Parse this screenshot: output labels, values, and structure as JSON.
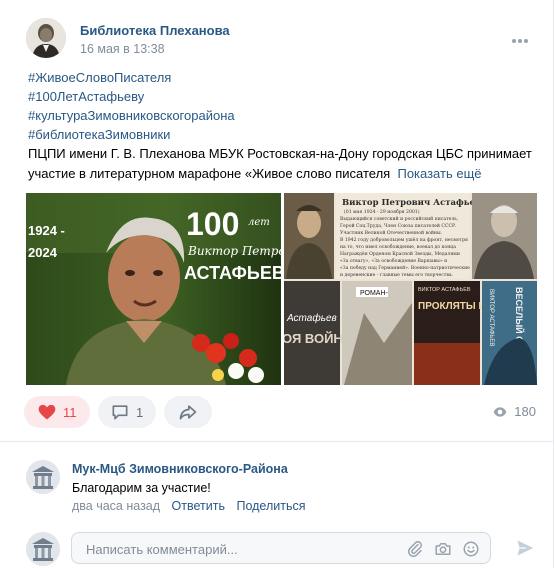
{
  "post": {
    "author": "Библиотека Плеханова",
    "date": "16 мая в 13:38",
    "hashtags": [
      "#ЖивоеСловоПисателя",
      "#100ЛетАстафьеву",
      "#культураЗимовниковскогорайона",
      "#библиотекаЗимовники"
    ],
    "text": "ПЦПИ имени Г. В. Плеханова МБУК Ростовская-на-Дону городская ЦБС принимает участие в литературном марафоне «Живое слово писателя",
    "show_more": "Показать ещё",
    "photo1": {
      "years_start": "1924 -",
      "years_end": "2024",
      "big_number": "100",
      "small_word": "лет",
      "script_name": "Виктор Петрович",
      "surname": "АСТАФЬЕВ"
    },
    "photo2": {
      "heading": "Виктор Петрович Астафьев",
      "bio_lines": [
        "(01 мая 1924 - 29 ноября 2001)",
        "Выдающийся советский и российский писатель,",
        "Герой Соц.Труда, Член Союза писателей СССР.",
        "Участник Великой Отечественной войны.",
        "В 1942 году добровольцем ушёл на фронт, несмотря",
        "на то, что имел освобождение, воевал до конца",
        "Награждён Орденом Красной Звезды, Медалями",
        "«За отвагу», «За освобождение Варшавы» и",
        "«За победу над Германией». Военно-патриотические",
        "и деревенские - главные темы его творчества."
      ],
      "book1_author": "Астафьев",
      "book1_title": "ОЯ ВОЙНА",
      "book2_author": "РОМАН-",
      "book3_author": "ВИКТОР АСТАФЬЕВ",
      "book3_title": "ПРОКЛЯТЫ И УБИТЫ",
      "book4_title": "ВЕСЕЛЫЙ СОЛДАТ",
      "book4_author": "ВИКТОР АСТАФЬЕВ"
    },
    "actions": {
      "likes": "11",
      "comments": "1",
      "views": "180"
    }
  },
  "comment": {
    "author": "Мук-Мцб Зимовниковского-Района",
    "text": "Благодарим за участие!",
    "time": "два часа назад",
    "reply_label": "Ответить",
    "share_label": "Поделиться"
  },
  "reply": {
    "placeholder": "Написать комментарий..."
  },
  "colors": {
    "link": "#2a5885",
    "meta": "#818c99",
    "like_red": "#e64646",
    "like_bg": "#fbe9ec",
    "button_bg": "#f0f2f5"
  },
  "icons": [
    "more-icon",
    "heart-icon",
    "comment-icon",
    "share-icon",
    "eye-icon",
    "paperclip-icon",
    "camera-icon",
    "smile-icon",
    "send-icon"
  ]
}
